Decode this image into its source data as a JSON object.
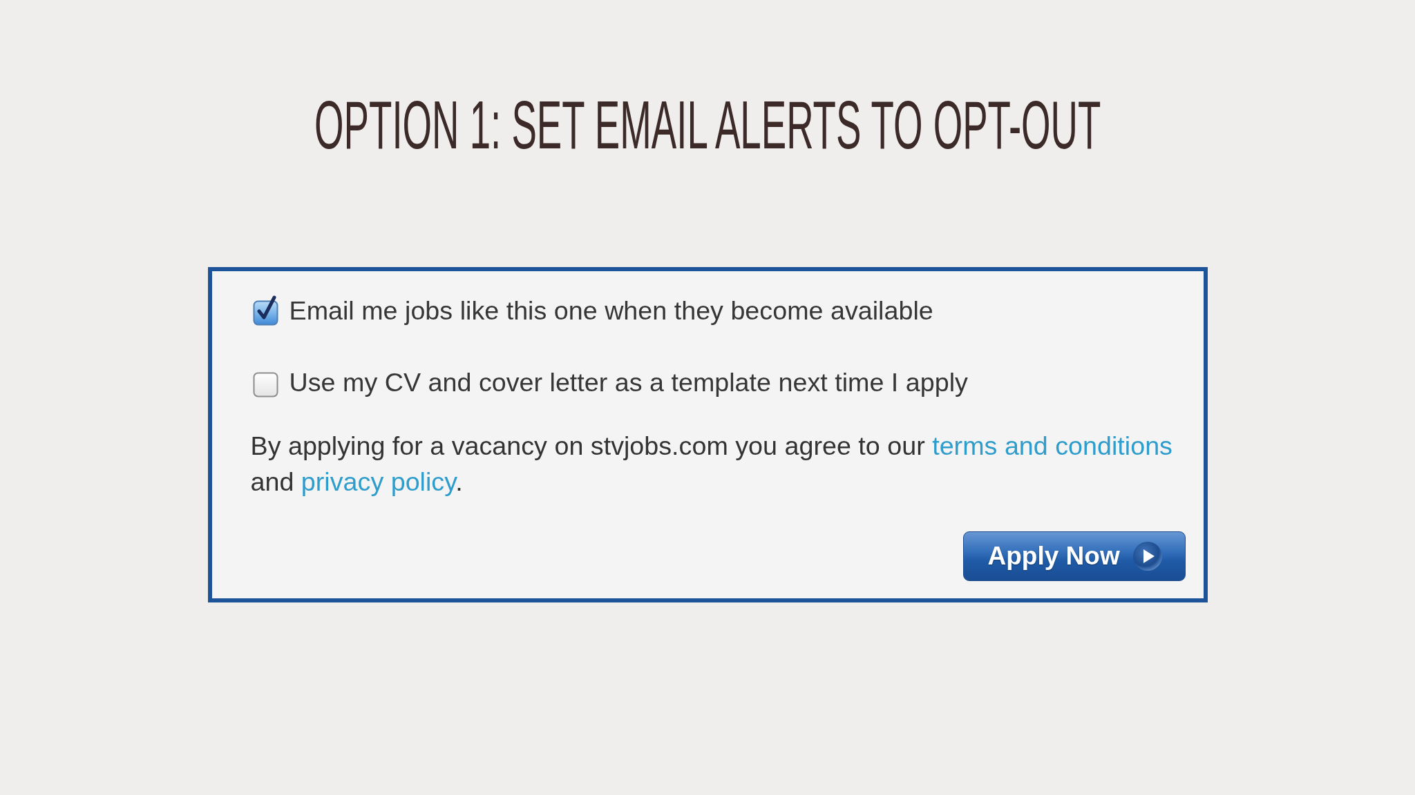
{
  "title": "OPTION 1: SET EMAIL ALERTS TO OPT-OUT",
  "form": {
    "options": [
      {
        "label": "Email me jobs like this one when they become available",
        "checked": true
      },
      {
        "label": "Use my CV and cover letter as a template next time I apply",
        "checked": false
      }
    ],
    "agreement": [
      {
        "kind": "text",
        "text": "By applying for a vacancy on stvjobs.com you agree to our "
      },
      {
        "kind": "link",
        "text": "terms and conditions"
      },
      {
        "kind": "text",
        "text": " and "
      },
      {
        "kind": "link",
        "text": "privacy policy"
      },
      {
        "kind": "text",
        "text": "."
      }
    ],
    "button": {
      "label": "Apply Now"
    }
  }
}
